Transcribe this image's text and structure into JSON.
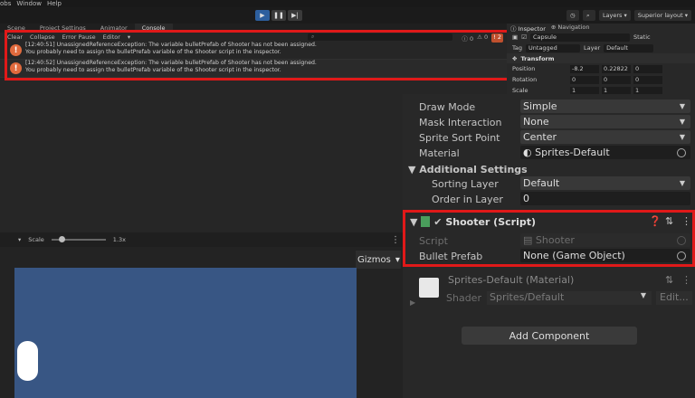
{
  "menu": {
    "items": [
      "obs",
      "Window",
      "Help"
    ]
  },
  "toolbar": {
    "layers_label": "Layers",
    "layout_label": "Superior layout"
  },
  "tabs": [
    {
      "label": "Scene"
    },
    {
      "label": "Project Settings"
    },
    {
      "label": "Animator"
    },
    {
      "label": "Console"
    }
  ],
  "console": {
    "buttons": [
      "Clear",
      "Collapse",
      "Error Pause",
      "Editor"
    ],
    "counts": {
      "info": "0",
      "warn": "0",
      "error": "2"
    },
    "entries": [
      {
        "line1": "[12:40:51] UnassignedReferenceException: The variable bulletPrefab of Shooter has not been assigned.",
        "line2": "You probably need to assign the bulletPrefab variable of the Shooter script in the inspector."
      },
      {
        "line1": "[12:40:52] UnassignedReferenceException: The variable bulletPrefab of Shooter has not been assigned.",
        "line2": "You probably need to assign the bulletPrefab variable of the Shooter script in the inspector."
      }
    ]
  },
  "scene_view": {
    "scale_label": "Scale",
    "scale_value": "1.3x",
    "gizmos_label": "Gizmos"
  },
  "inspector": {
    "tabs": [
      "Inspector",
      "Navigation"
    ],
    "object_name": "Capsule",
    "static_label": "Static",
    "tag_label": "Tag",
    "tag_value": "Untagged",
    "layer_label": "Layer",
    "layer_value": "Default",
    "transform_label": "Transform",
    "position": {
      "label": "Position",
      "x": "-8.2",
      "y": "0.22822",
      "z": "0"
    },
    "rotation": {
      "label": "Rotation",
      "x": "0",
      "y": "0",
      "z": "0"
    },
    "scale": {
      "label": "Scale",
      "x": "1",
      "y": "1",
      "z": "1"
    }
  },
  "sprite_renderer": {
    "draw_mode_label": "Draw Mode",
    "draw_mode_value": "Simple",
    "mask_label": "Mask Interaction",
    "mask_value": "None",
    "sort_point_label": "Sprite Sort Point",
    "sort_point_value": "Center",
    "material_label": "Material",
    "material_value": "Sprites-Default",
    "additional_settings_label": "Additional Settings",
    "sorting_layer_label": "Sorting Layer",
    "sorting_layer_value": "Default",
    "order_label": "Order in Layer",
    "order_value": "0"
  },
  "shooter": {
    "title": "Shooter (Script)",
    "script_label": "Script",
    "script_value": "Shooter",
    "bullet_label": "Bullet Prefab",
    "bullet_value": "None (Game Object)"
  },
  "material": {
    "title": "Sprites-Default (Material)",
    "shader_label": "Shader",
    "shader_value": "Sprites/Default",
    "edit_label": "Edit..."
  },
  "add_component_label": "Add Component",
  "colors": {
    "highlight": "#e01919",
    "error": "#e06a3d",
    "game_bg": "#385684",
    "play_active": "#2d5f9e"
  }
}
